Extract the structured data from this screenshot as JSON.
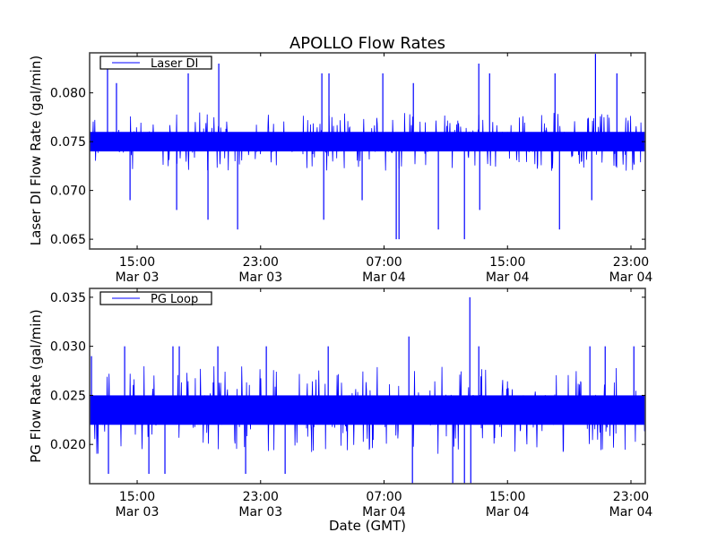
{
  "chart_data": [
    {
      "type": "line",
      "title": "APOLLO Flow Rates",
      "xlabel": "",
      "ylabel": "Laser DI Flow Rate (gal/min)",
      "x_unit": "hours since Mar 03 00:00 GMT",
      "xlim": [
        11.92,
        47.93
      ],
      "ylim": [
        0.064,
        0.0841
      ],
      "yticks": [
        {
          "v": 0.08,
          "label": "0.080"
        },
        {
          "v": 0.075,
          "label": "0.075"
        },
        {
          "v": 0.07,
          "label": "0.070"
        },
        {
          "v": 0.065,
          "label": "0.065"
        }
      ],
      "xticks": [
        {
          "v": 15,
          "time": "15:00",
          "date": "Mar 03"
        },
        {
          "v": 23,
          "time": "23:00",
          "date": "Mar 03"
        },
        {
          "v": 31,
          "time": "07:00",
          "date": "Mar 04"
        },
        {
          "v": 39,
          "time": "15:00",
          "date": "Mar 04"
        },
        {
          "v": 47,
          "time": "23:00",
          "date": "Mar 04"
        }
      ],
      "legend": {
        "label": "Laser DI",
        "placement": "top-left"
      },
      "color": "#0000ff",
      "series": [
        {
          "name": "Laser DI",
          "typical_band": [
            0.074,
            0.076
          ],
          "noise_range": [
            0.072,
            0.078
          ],
          "spikes": [
            [
              13.08,
              0.0825
            ],
            [
              13.66,
              0.081
            ],
            [
              18.31,
              0.082
            ],
            [
              20.29,
              0.083
            ],
            [
              26.97,
              0.082
            ],
            [
              27.43,
              0.082
            ],
            [
              30.92,
              0.082
            ],
            [
              32.9,
              0.081
            ],
            [
              37.14,
              0.083
            ],
            [
              37.84,
              0.082
            ],
            [
              42.08,
              0.082
            ],
            [
              44.7,
              0.084
            ],
            [
              46.09,
              0.082
            ],
            [
              14.54,
              0.069
            ],
            [
              17.56,
              0.068
            ],
            [
              19.59,
              0.067
            ],
            [
              21.51,
              0.066
            ],
            [
              27.09,
              0.067
            ],
            [
              29.58,
              0.069
            ],
            [
              31.79,
              0.065
            ],
            [
              31.97,
              0.065
            ],
            [
              34.52,
              0.066
            ],
            [
              36.21,
              0.065
            ],
            [
              37.2,
              0.068
            ],
            [
              42.37,
              0.066
            ],
            [
              44.46,
              0.069
            ]
          ]
        }
      ]
    },
    {
      "type": "line",
      "title": "",
      "xlabel": "Date (GMT)",
      "ylabel": "PG Flow Rate (gal/min)",
      "x_unit": "hours since Mar 03 00:00 GMT",
      "xlim": [
        11.92,
        47.93
      ],
      "ylim": [
        0.016,
        0.0359
      ],
      "yticks": [
        {
          "v": 0.035,
          "label": "0.035"
        },
        {
          "v": 0.03,
          "label": "0.030"
        },
        {
          "v": 0.025,
          "label": "0.025"
        },
        {
          "v": 0.02,
          "label": "0.020"
        }
      ],
      "xticks": [
        {
          "v": 15,
          "time": "15:00",
          "date": "Mar 03"
        },
        {
          "v": 23,
          "time": "23:00",
          "date": "Mar 03"
        },
        {
          "v": 31,
          "time": "07:00",
          "date": "Mar 04"
        },
        {
          "v": 39,
          "time": "15:00",
          "date": "Mar 04"
        },
        {
          "v": 47,
          "time": "23:00",
          "date": "Mar 04"
        }
      ],
      "legend": {
        "label": "PG Loop",
        "placement": "top-left"
      },
      "color": "#0000ff",
      "series": [
        {
          "name": "PG Loop",
          "typical_band": [
            0.022,
            0.025
          ],
          "noise_range": [
            0.019,
            0.028
          ],
          "spikes": [
            [
              12.04,
              0.029
            ],
            [
              14.19,
              0.03
            ],
            [
              17.32,
              0.03
            ],
            [
              17.73,
              0.03
            ],
            [
              20.23,
              0.03
            ],
            [
              23.37,
              0.03
            ],
            [
              27.38,
              0.03
            ],
            [
              32.61,
              0.031
            ],
            [
              36.56,
              0.035
            ],
            [
              37.14,
              0.03
            ],
            [
              44.34,
              0.03
            ],
            [
              45.33,
              0.03
            ],
            [
              47.19,
              0.03
            ],
            [
              13.14,
              0.017
            ],
            [
              15.76,
              0.017
            ],
            [
              16.8,
              0.017
            ],
            [
              22.03,
              0.017
            ],
            [
              24.59,
              0.017
            ],
            [
              32.84,
              0.016
            ],
            [
              35.45,
              0.016
            ],
            [
              36.21,
              0.016
            ],
            [
              36.62,
              0.016
            ]
          ]
        }
      ]
    }
  ]
}
